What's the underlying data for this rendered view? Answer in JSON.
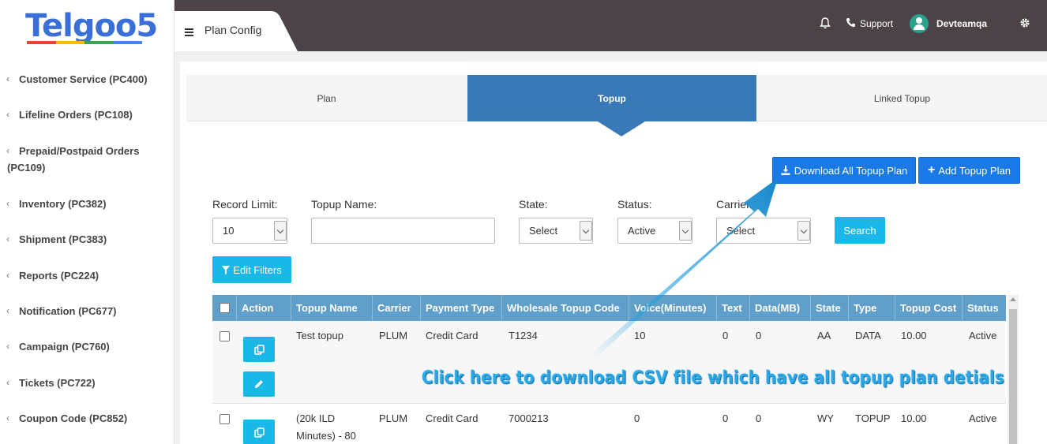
{
  "app": {
    "logo_text": "Telgoo5",
    "logo_colors": [
      "#ea4335",
      "#fbbc05",
      "#34a853",
      "#4285f4"
    ],
    "brand_color": "#3b6fd8"
  },
  "sidebar": {
    "items": [
      {
        "label": "Customer Service (PC400)"
      },
      {
        "label": "Lifeline Orders (PC108)"
      },
      {
        "label": "Prepaid/Postpaid Orders",
        "label_line2": "(PC109)"
      },
      {
        "label": "Inventory (PC382)"
      },
      {
        "label": "Shipment (PC383)"
      },
      {
        "label": "Reports (PC224)"
      },
      {
        "label": "Notification (PC677)"
      },
      {
        "label": "Campaign (PC760)"
      },
      {
        "label": "Tickets (PC722)"
      },
      {
        "label": "Coupon Code (PC852)"
      }
    ]
  },
  "header": {
    "page_title": "Plan Config",
    "support_label": "Support",
    "user_name": "Devteamqa",
    "icons": [
      "hamburger-icon",
      "bell-icon",
      "phone-icon",
      "user-avatar-icon",
      "gear-icon"
    ]
  },
  "tabs": [
    {
      "label": "Plan",
      "active": false
    },
    {
      "label": "Topup",
      "active": true
    },
    {
      "label": "Linked Topup",
      "active": false
    }
  ],
  "actions": {
    "download_label": "Download All Topup Plan",
    "add_label": "Add Topup Plan",
    "edit_filters_label": "Edit Filters",
    "search_label": "Search"
  },
  "filters": {
    "record_limit": {
      "label": "Record Limit:",
      "value": "10"
    },
    "topup_name": {
      "label": "Topup Name:",
      "value": ""
    },
    "state": {
      "label": "State:",
      "value": "Select"
    },
    "status": {
      "label": "Status:",
      "value": "Active"
    },
    "carrier": {
      "label": "Carrier:",
      "value": "Select"
    }
  },
  "table": {
    "columns": [
      "Action",
      "Topup Name",
      "Carrier",
      "Payment Type",
      "Wholesale Topup Code",
      "Voice(Minutes)",
      "Text",
      "Data(MB)",
      "State",
      "Type",
      "Topup Cost",
      "Status"
    ],
    "rows": [
      {
        "topup_name": "Test topup",
        "topup_name_line2": "",
        "carrier": "PLUM",
        "payment_type": "Credit Card",
        "wholesale_code": "T1234",
        "voice": "10",
        "text": "0",
        "data": "0",
        "state": "AA",
        "type": "DATA",
        "cost": "10.00",
        "status": "Active"
      },
      {
        "topup_name": "(20k ILD",
        "topup_name_line2": "Minutes) - 80",
        "carrier": "PLUM",
        "payment_type": "Credit Card",
        "wholesale_code": "7000213",
        "voice": "0",
        "text": "0",
        "data": "0",
        "state": "WY",
        "type": "TOPUP",
        "cost": "10.00",
        "status": "Active"
      }
    ]
  },
  "annotation": {
    "text": "Click here to download CSV file which have all topup plan detials",
    "color": "#28a8e6"
  }
}
